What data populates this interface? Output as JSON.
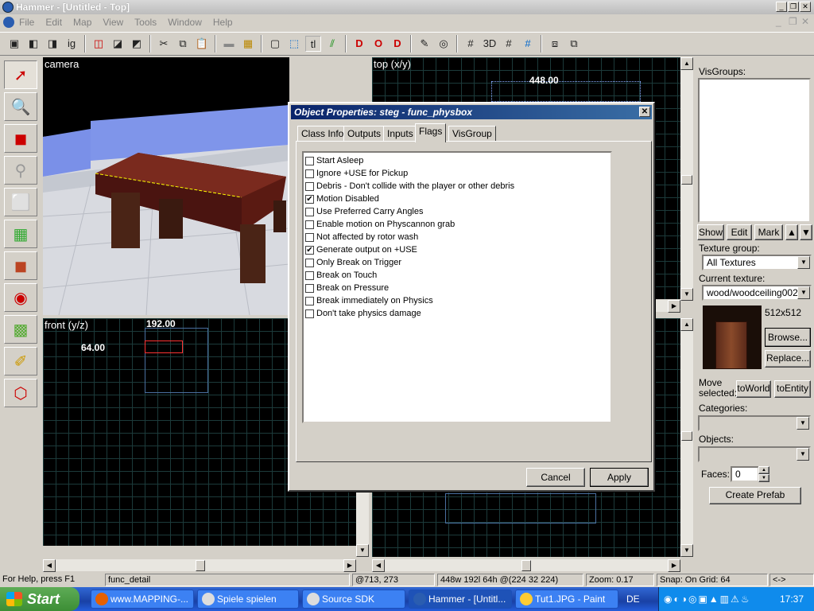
{
  "window": {
    "title": "Hammer - [Untitled - Top]"
  },
  "menu": [
    "File",
    "Edit",
    "Map",
    "View",
    "Tools",
    "Window",
    "Help"
  ],
  "viewports": {
    "camera": {
      "label": "camera"
    },
    "top": {
      "label": "top (x/y)",
      "dim_label": "448.00"
    },
    "front": {
      "label": "front (y/z)",
      "dim_width": "192.00",
      "dim_height": "64.00"
    }
  },
  "right_panel": {
    "visgroups_label": "VisGroups:",
    "show": "Show",
    "edit": "Edit",
    "mark": "Mark",
    "texture_group_label": "Texture group:",
    "texture_group_value": "All Textures",
    "current_texture_label": "Current texture:",
    "current_texture_value": "wood/woodceiling002a",
    "texture_size": "512x512",
    "browse": "Browse...",
    "replace": "Replace...",
    "move_selected_label": "Move selected:",
    "to_world": "toWorld",
    "to_entity": "toEntity",
    "categories_label": "Categories:",
    "objects_label": "Objects:",
    "faces_label": "Faces:",
    "faces_value": "0",
    "create_prefab": "Create Prefab"
  },
  "dialog": {
    "title": "Object Properties: steg - func_physbox",
    "tabs": [
      "Class Info",
      "Outputs",
      "Inputs",
      "Flags",
      "VisGroup"
    ],
    "selected_tab": "Flags",
    "flags": [
      {
        "label": "Start Asleep",
        "checked": false
      },
      {
        "label": "Ignore +USE for Pickup",
        "checked": false
      },
      {
        "label": "Debris - Don't collide with the player or other debris",
        "checked": false
      },
      {
        "label": "Motion Disabled",
        "checked": true
      },
      {
        "label": "Use Preferred Carry Angles",
        "checked": false
      },
      {
        "label": "Enable motion on Physcannon grab",
        "checked": false
      },
      {
        "label": "Not affected by rotor wash",
        "checked": false
      },
      {
        "label": "Generate output on +USE",
        "checked": true
      },
      {
        "label": "Only Break on Trigger",
        "checked": false
      },
      {
        "label": "Break on Touch",
        "checked": false
      },
      {
        "label": "Break on Pressure",
        "checked": false
      },
      {
        "label": "Break immediately on Physics",
        "checked": false
      },
      {
        "label": "Don't take physics damage",
        "checked": false
      }
    ],
    "cancel": "Cancel",
    "apply": "Apply"
  },
  "status": {
    "help": "For Help, press F1",
    "selection": "func_detail",
    "cursor": "@713, 273",
    "size": "448w 192l 64h @(224 32 224)",
    "zoom": "Zoom: 0.17",
    "snap": "Snap: On Grid: 64",
    "extra": "<->"
  },
  "taskbar": {
    "start": "Start",
    "tasks": [
      "www.MAPPING-...",
      "Spiele spielen",
      "Source SDK",
      "Hammer - [Untitl...",
      "Tut1.JPG - Paint"
    ],
    "lang": "DE",
    "clock": "17:37"
  },
  "colors": {
    "dialog_title_start": "#0a246a",
    "dialog_title_end": "#3a6ea5",
    "taskbar": "#245edb",
    "start_green": "#3c8e35"
  }
}
